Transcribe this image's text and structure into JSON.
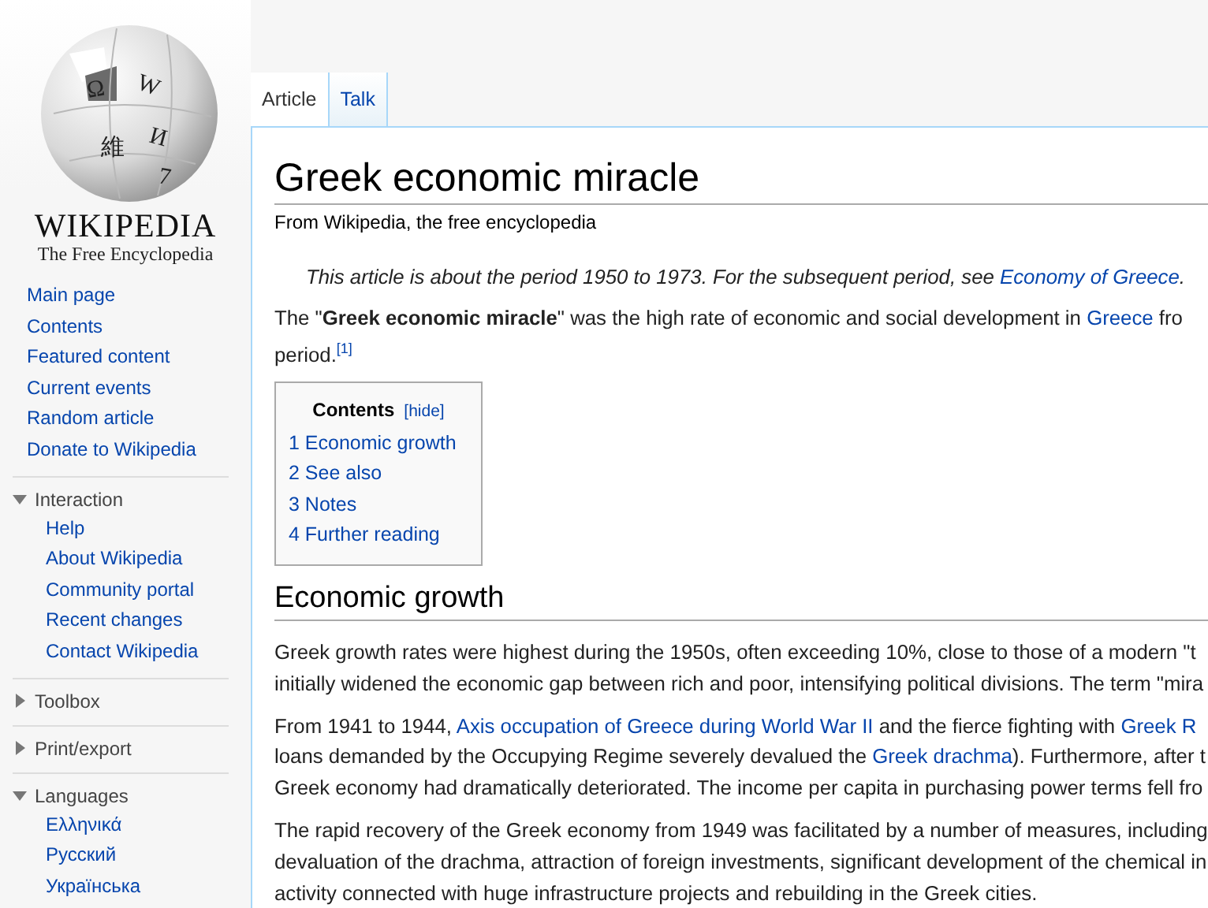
{
  "logo": {
    "glyphs": [
      "Ω",
      "W",
      "И",
      "維",
      "7"
    ],
    "wordmark": "WIKIPEDIA",
    "tagline": "The Free Encyclopedia"
  },
  "navigation": [
    "Main page",
    "Contents",
    "Featured content",
    "Current events",
    "Random article",
    "Donate to Wikipedia"
  ],
  "portals": [
    {
      "title": "Interaction",
      "expanded": true,
      "items": [
        "Help",
        "About Wikipedia",
        "Community portal",
        "Recent changes",
        "Contact Wikipedia"
      ]
    },
    {
      "title": "Toolbox",
      "expanded": false
    },
    {
      "title": "Print/export",
      "expanded": false
    },
    {
      "title": "Languages",
      "expanded": true,
      "items": [
        "Ελληνικά",
        "Русский",
        "Українська"
      ]
    }
  ],
  "tabs": [
    {
      "label": "Article",
      "selected": true
    },
    {
      "label": "Talk",
      "selected": false
    }
  ],
  "title": "Greek economic miracle",
  "tagline": "From Wikipedia, the free encyclopedia",
  "hatnote": [
    {
      "kind": "text",
      "text": "This article is about the period 1950 to 1973. For the subsequent period, see "
    },
    {
      "kind": "link",
      "text": "Economy of Greece"
    },
    {
      "kind": "text",
      "text": "."
    }
  ],
  "intro": [
    [
      {
        "kind": "text",
        "text": "The \"**Greek economic miracle**\" was the high rate of economic and social development in "
      },
      {
        "kind": "link",
        "text": "Greece"
      },
      {
        "kind": "text",
        "text": " fro"
      }
    ],
    [
      {
        "kind": "text",
        "text": "period."
      },
      {
        "kind": "footnote",
        "text": "[1]"
      }
    ]
  ],
  "toc": {
    "title": "Contents",
    "toggle": "[hide]",
    "items": [
      "1 Economic growth",
      "2 See also",
      "3 Notes",
      "4 Further reading"
    ]
  },
  "sections": [
    {
      "heading": "Economic growth",
      "paragraphs": [
        [
          [
            {
              "kind": "text",
              "text": "Greek growth rates were highest during the 1950s, often exceeding 10%, close to those of a modern \"t"
            }
          ],
          [
            {
              "kind": "text",
              "text": "initially widened the economic gap between rich and poor, intensifying political divisions. The term \"mira"
            }
          ]
        ],
        [
          [
            {
              "kind": "text",
              "text": "From 1941 to 1944, "
            },
            {
              "kind": "link",
              "text": "Axis occupation of Greece during World War II"
            },
            {
              "kind": "text",
              "text": " and the fierce fighting with "
            },
            {
              "kind": "link",
              "text": "Greek R"
            }
          ],
          [
            {
              "kind": "text",
              "text": "loans demanded by the Occupying Regime severely devalued the "
            },
            {
              "kind": "link",
              "text": "Greek drachma"
            },
            {
              "kind": "text",
              "text": "). Furthermore, after t"
            }
          ],
          [
            {
              "kind": "text",
              "text": "Greek economy had dramatically deteriorated. The income per capita in purchasing power terms fell fro"
            }
          ]
        ],
        [
          [
            {
              "kind": "text",
              "text": "The rapid recovery of the Greek economy from 1949 was facilitated by a number of measures, including"
            }
          ],
          [
            {
              "kind": "text",
              "text": "devaluation of the drachma, attraction of foreign investments, significant development of the chemical in"
            }
          ],
          [
            {
              "kind": "text",
              "text": "activity connected with huge infrastructure projects and rebuilding in the Greek cities."
            }
          ]
        ]
      ]
    }
  ]
}
